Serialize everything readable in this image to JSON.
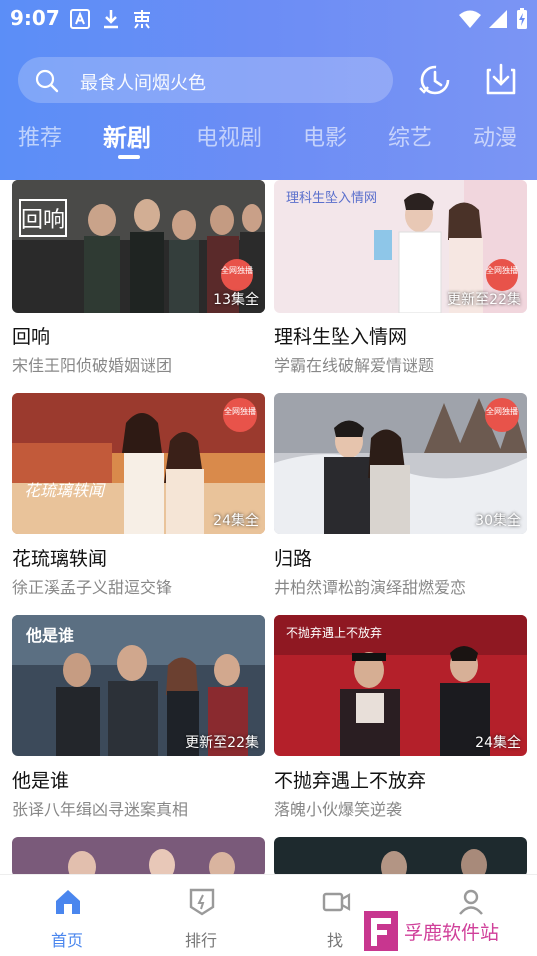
{
  "status_bar": {
    "time": "9:07"
  },
  "search": {
    "placeholder_text": "最食人间烟火色"
  },
  "tabs": [
    {
      "label": "推荐",
      "active": false
    },
    {
      "label": "新剧",
      "active": true
    },
    {
      "label": "电视剧",
      "active": false
    },
    {
      "label": "电影",
      "active": false
    },
    {
      "label": "综艺",
      "active": false
    },
    {
      "label": "动漫",
      "active": false
    }
  ],
  "cards": [
    {
      "title": "回响",
      "subtitle": "宋佳王阳侦破婚姻谜团",
      "episodes": "13集全",
      "poster_text": "回响",
      "exclusive_tag": "全网独播"
    },
    {
      "title": "理科生坠入情网",
      "subtitle": "学霸在线破解爱情谜题",
      "episodes": "更新至22集",
      "poster_text": "理科生坠入情网",
      "exclusive_tag": "全网独播"
    },
    {
      "title": "花琉璃轶闻",
      "subtitle": "徐正溪孟子义甜逗交锋",
      "episodes": "24集全",
      "poster_text": "花琉璃轶闻",
      "exclusive_tag": "全网独播"
    },
    {
      "title": "归路",
      "subtitle": "井柏然谭松韵演绎甜燃爱恋",
      "episodes": "30集全",
      "exclusive_tag": "全网独播"
    },
    {
      "title": "他是谁",
      "subtitle": "张译八年缉凶寻迷案真相",
      "episodes": "更新至22集",
      "poster_text": "他是谁"
    },
    {
      "title": "不抛弃遇上不放弃",
      "subtitle": "落魄小伙爆笑逆袭",
      "episodes": "24集全",
      "poster_text": "不抛弃遇上不放弃"
    }
  ],
  "bottom_nav": [
    {
      "label": "首页",
      "icon": "home-icon",
      "active": true
    },
    {
      "label": "排行",
      "icon": "ranking-icon",
      "active": false
    },
    {
      "label": "找",
      "icon": "video-icon",
      "active": false
    },
    {
      "label": "",
      "icon": "user-icon",
      "active": false
    }
  ],
  "watermark": {
    "text": "孚鹿软件站"
  },
  "colors": {
    "header_start": "#5b8ef7",
    "header_end": "#7b95f4",
    "accent": "#4a86ee",
    "badge": "#e8534a"
  }
}
